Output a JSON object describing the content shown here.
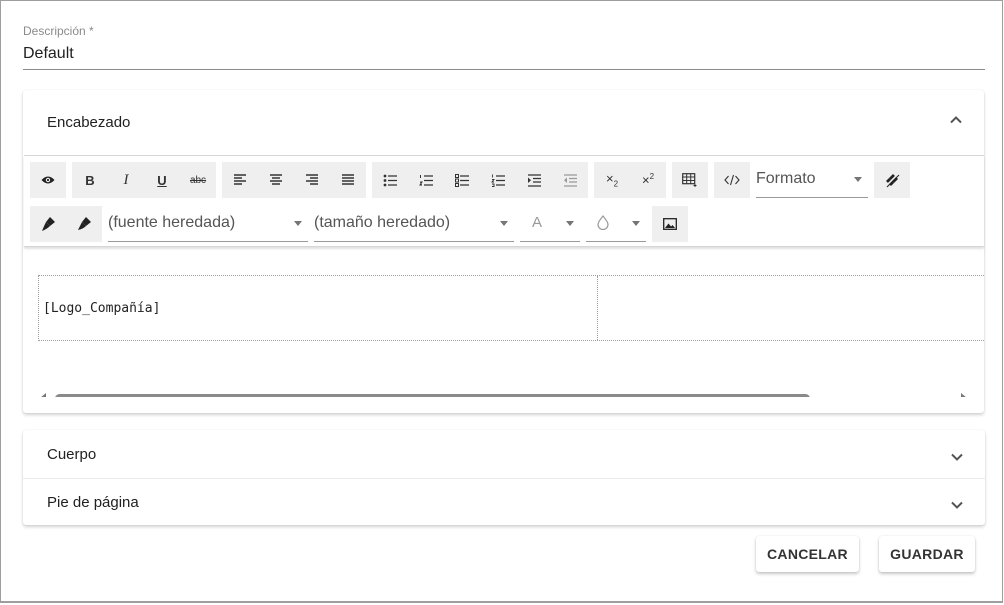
{
  "form": {
    "description_label": "Descripción *",
    "description_value": "Default"
  },
  "sections": {
    "header": {
      "title": "Encabezado",
      "expanded": true
    },
    "body": {
      "title": "Cuerpo",
      "expanded": false
    },
    "footer": {
      "title": "Pie de página",
      "expanded": false
    }
  },
  "toolbar": {
    "bold": "B",
    "italic": "I",
    "underline": "U",
    "strike": "abc",
    "format_select": "Formato",
    "font_select": "(fuente heredada)",
    "size_select": "(tamaño heredado)",
    "text_color": "A"
  },
  "editor": {
    "cell_text": "[Logo_Compañía]"
  },
  "actions": {
    "cancel": "CANCELAR",
    "save": "GUARDAR"
  }
}
